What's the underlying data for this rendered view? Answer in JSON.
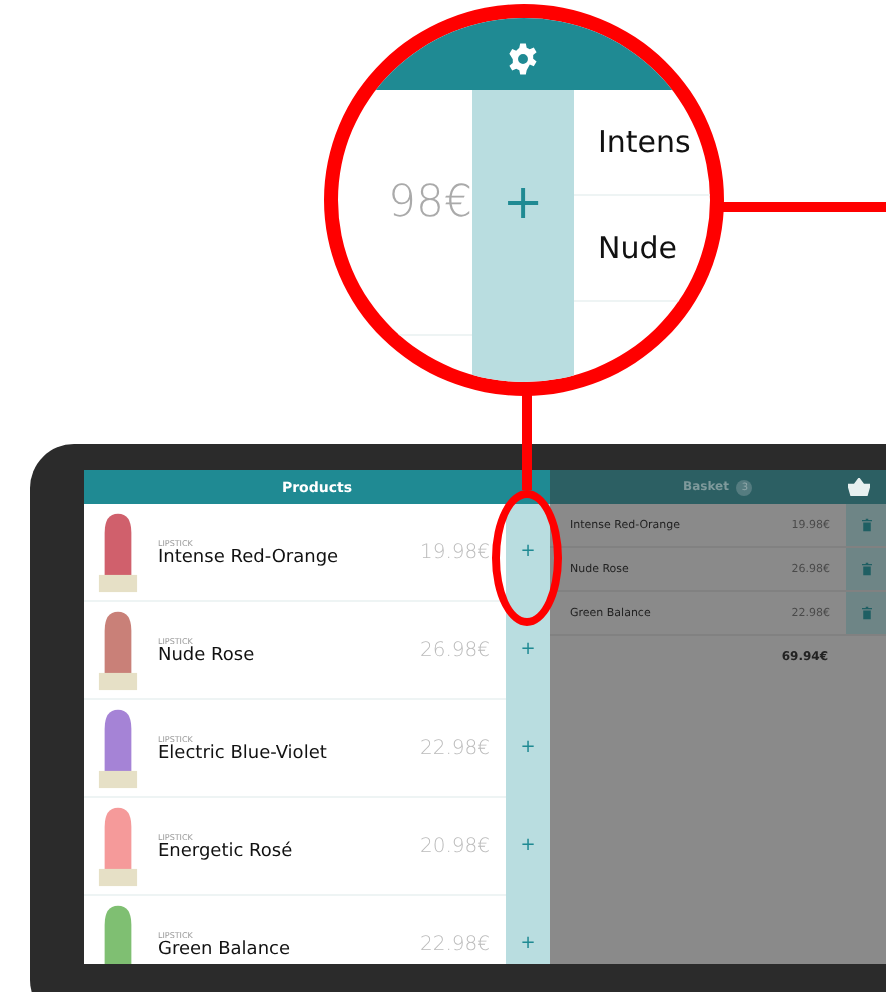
{
  "magnifier": {
    "price": "98€",
    "add_label": "+",
    "items": [
      "Intens",
      "Nude"
    ]
  },
  "products": {
    "title": "Products",
    "rows": [
      {
        "category": "LIPSTICK",
        "name": "Intense Red-Orange",
        "price": "19.98€",
        "add_label": "+",
        "color": "#d0606c"
      },
      {
        "category": "LIPSTICK",
        "name": "Nude Rose",
        "price": "26.98€",
        "add_label": "+",
        "color": "#c98078"
      },
      {
        "category": "LIPSTICK",
        "name": "Electric Blue-Violet",
        "price": "22.98€",
        "add_label": "+",
        "color": "#a583d6"
      },
      {
        "category": "LIPSTICK",
        "name": "Energetic Rosé",
        "price": "20.98€",
        "add_label": "+",
        "color": "#f59a9a"
      },
      {
        "category": "LIPSTICK",
        "name": "Green Balance",
        "price": "22.98€",
        "add_label": "+",
        "color": "#7fbf72"
      }
    ]
  },
  "basket": {
    "title": "Basket",
    "count": "3",
    "items": [
      {
        "name": "Intense Red-Orange",
        "price": "19.98€"
      },
      {
        "name": "Nude Rose",
        "price": "26.98€"
      },
      {
        "name": "Green Balance",
        "price": "22.98€"
      }
    ],
    "total": "69.94€"
  }
}
